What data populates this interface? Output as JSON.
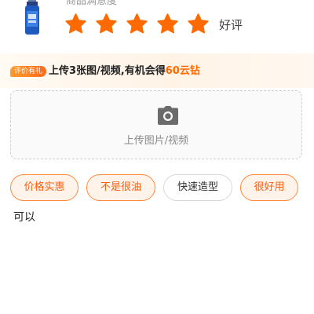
{
  "product": {
    "satisfaction_label": "商品满意度",
    "rating": 5,
    "max_rating": 5,
    "rating_text": "好评"
  },
  "promo": {
    "badge": "评价有礼",
    "text_prefix": "上传3张图/视频,有机会得",
    "text_highlight": "60云钻"
  },
  "upload": {
    "label": "上传图片/视频",
    "icon": "camera-icon"
  },
  "tags": [
    {
      "label": "价格实惠",
      "selected": true
    },
    {
      "label": "不是很油",
      "selected": true
    },
    {
      "label": "快速造型",
      "selected": false
    },
    {
      "label": "很好用",
      "selected": true
    }
  ],
  "comment": {
    "text": "可以"
  },
  "colors": {
    "accent": "#ff6a00",
    "star": "#ff6a00",
    "tag_selected_bg": "#fff3ea",
    "tag_selected_border": "#ff8a3d"
  }
}
